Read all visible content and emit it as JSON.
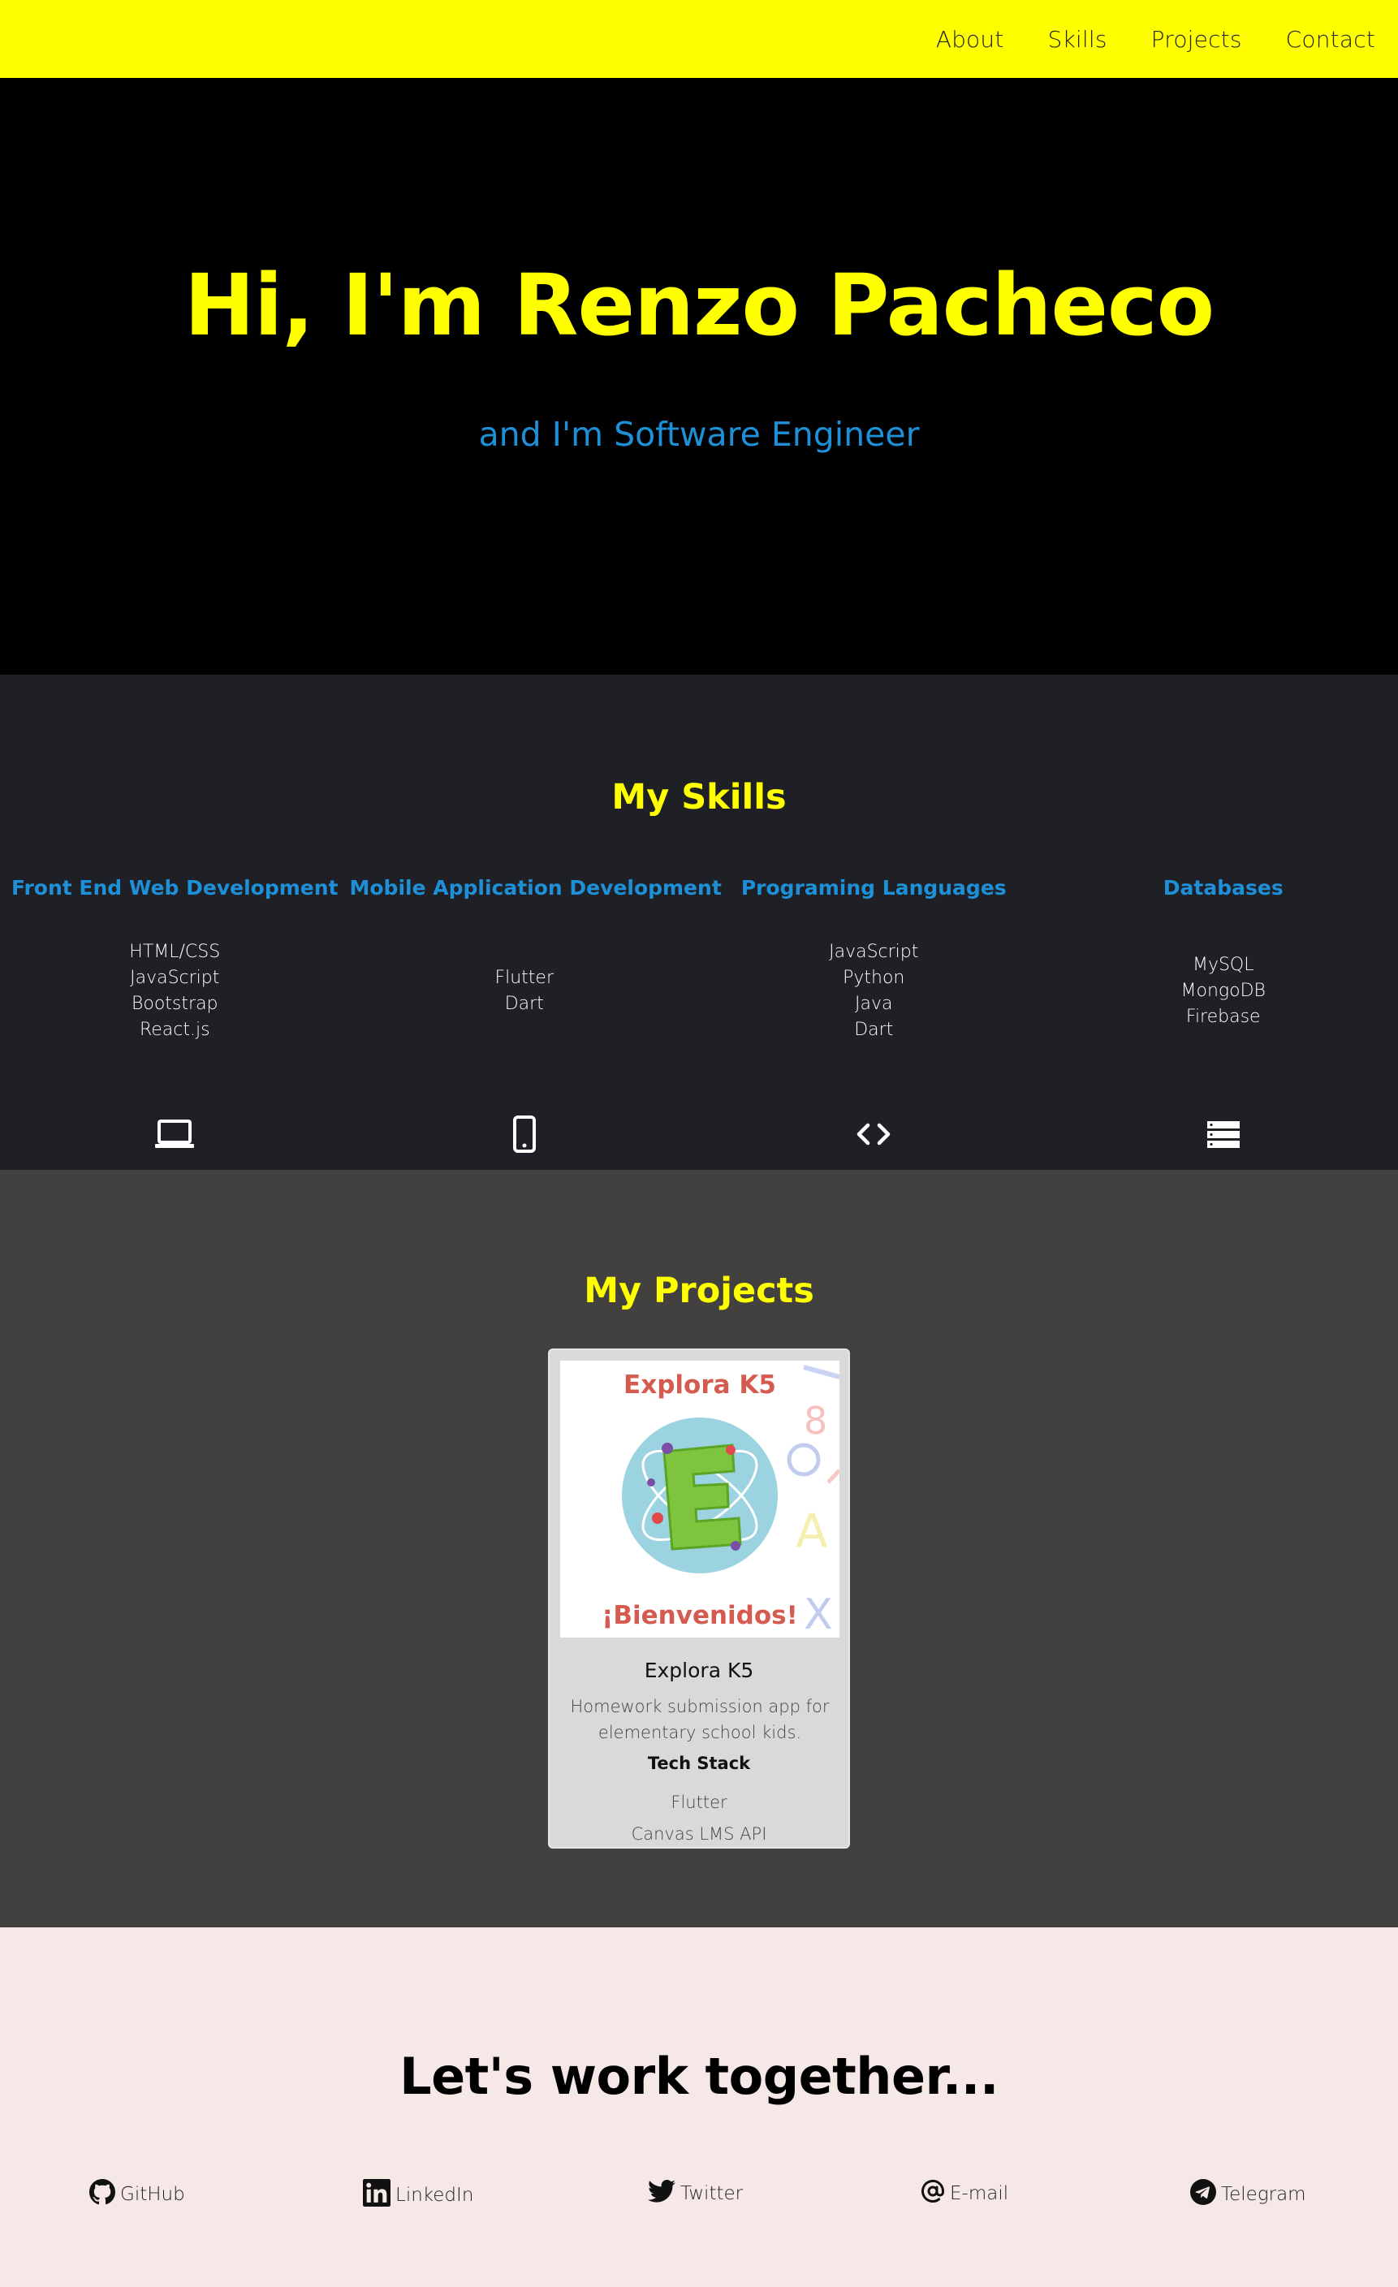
{
  "nav": {
    "items": [
      {
        "label": "About"
      },
      {
        "label": "Skills"
      },
      {
        "label": "Projects"
      },
      {
        "label": "Contact"
      }
    ]
  },
  "hero": {
    "title": "Hi, I'm Renzo Pacheco",
    "subtitle": "and I'm Software Engineer"
  },
  "skills": {
    "title": "My Skills",
    "columns": [
      {
        "heading": "Front End Web Development",
        "items": [
          "HTML/CSS",
          "JavaScript",
          "Bootstrap",
          "React.js"
        ],
        "icon": "laptop-icon"
      },
      {
        "heading": "Mobile Application Development",
        "items": [
          "Flutter",
          "Dart"
        ],
        "icon": "mobile-phone-icon"
      },
      {
        "heading": "Programing Languages",
        "items": [
          "JavaScript",
          "Python",
          "Java",
          "Dart"
        ],
        "icon": "code-icon"
      },
      {
        "heading": "Databases",
        "items": [
          "MySQL",
          "MongoDB",
          "Firebase"
        ],
        "icon": "database-server-icon"
      }
    ]
  },
  "projects": {
    "title": "My Projects",
    "cards": [
      {
        "image": {
          "top_text": "Explora K5",
          "bottom_text": "¡Bienvenidos!"
        },
        "title": "Explora K5",
        "description": "Homework submission app for elementary school kids.",
        "tech_label": "Tech Stack",
        "stack": [
          "Flutter",
          "Canvas LMS API"
        ]
      }
    ]
  },
  "contact": {
    "title": "Let's work together...",
    "links": [
      {
        "label": "GitHub",
        "icon": "github-icon"
      },
      {
        "label": "LinkedIn",
        "icon": "linkedin-icon"
      },
      {
        "label": "Twitter",
        "icon": "twitter-icon"
      },
      {
        "label": "E-mail",
        "icon": "at-sign-icon"
      },
      {
        "label": "Telegram",
        "icon": "telegram-icon"
      }
    ]
  },
  "colors": {
    "nav_bg": "#ffff00",
    "accent_yellow": "#ffff00",
    "accent_blue": "#1e90d8",
    "skills_bg": "#1f1f26",
    "projects_bg": "#434040",
    "contact_bg": "#f5e8e6"
  }
}
